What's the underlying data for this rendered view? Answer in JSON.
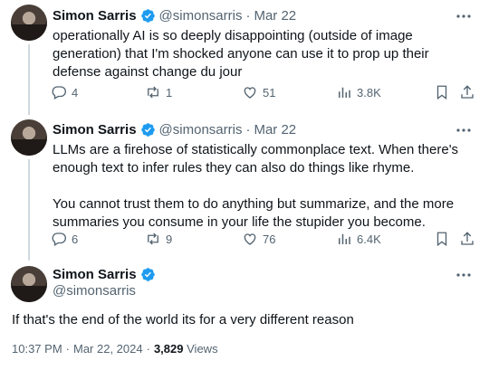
{
  "tweets": [
    {
      "name": "Simon Sarris",
      "handle": "@simonsarris",
      "dot": "·",
      "date": "Mar 22",
      "text": "operationally AI is so deeply disappointing (outside of image generation) that I'm shocked anyone can use it to prop up their defense against change du jour",
      "replies": "4",
      "reposts": "1",
      "likes": "51",
      "views": "3.8K"
    },
    {
      "name": "Simon Sarris",
      "handle": "@simonsarris",
      "dot": "·",
      "date": "Mar 22",
      "text1": "LLMs are a firehose of statistically commonplace text. When there's enough text to infer rules they can also do things like rhyme.",
      "text2": "You cannot trust them to do anything but summarize, and the more summaries you consume in your life the stupider you become.",
      "replies": "6",
      "reposts": "9",
      "likes": "76",
      "views": "6.4K"
    }
  ],
  "main": {
    "name": "Simon Sarris",
    "handle": "@simonsarris",
    "text": "If that's the end of the world its for a very different reason",
    "time": "10:37 PM",
    "dot": "·",
    "date": "Mar 22, 2024",
    "dot2": "·",
    "views_count": "3,829",
    "views_label": "Views"
  },
  "colors": {
    "verified": "#1d9bf0",
    "muted": "#536471",
    "text": "#0f1419",
    "line": "#cfd9de"
  }
}
